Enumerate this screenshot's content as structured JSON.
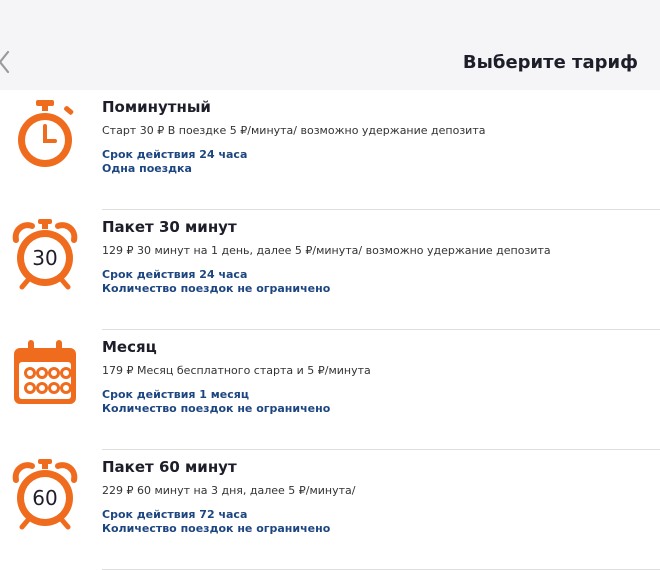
{
  "header": {
    "title": "Выберите тариф"
  },
  "accent_color": "#ef6c1e",
  "link_color": "#1d4680",
  "tariffs": [
    {
      "icon": "stopwatch-icon",
      "name": "Поминутный",
      "description": "Старт 30 ₽ В поездке 5 ₽/минута/  возможно удержание депозита",
      "validity": "Срок действия 24 часа",
      "rides": "Одна поездка"
    },
    {
      "icon": "alarm-clock-30-icon",
      "badge": "30",
      "name": "Пакет 30 минут",
      "description": "129 ₽ 30 минут на 1 день, далее 5 ₽/минута/  возможно удержание депозита",
      "validity": "Срок действия 24 часа",
      "rides": "Количество поездок не ограничено"
    },
    {
      "icon": "calendar-icon",
      "name": "Месяц",
      "description": "179 ₽ Месяц бесплатного старта и 5 ₽/минута",
      "validity": "Срок действия 1 месяц",
      "rides": "Количество поездок не ограничено"
    },
    {
      "icon": "alarm-clock-60-icon",
      "badge": "60",
      "name": "Пакет 60 минут",
      "description": "229 ₽ 60 минут на 3 дня, далее 5 ₽/минута/",
      "validity": "Срок действия 72 часа",
      "rides": "Количество поездок не ограничено"
    }
  ]
}
